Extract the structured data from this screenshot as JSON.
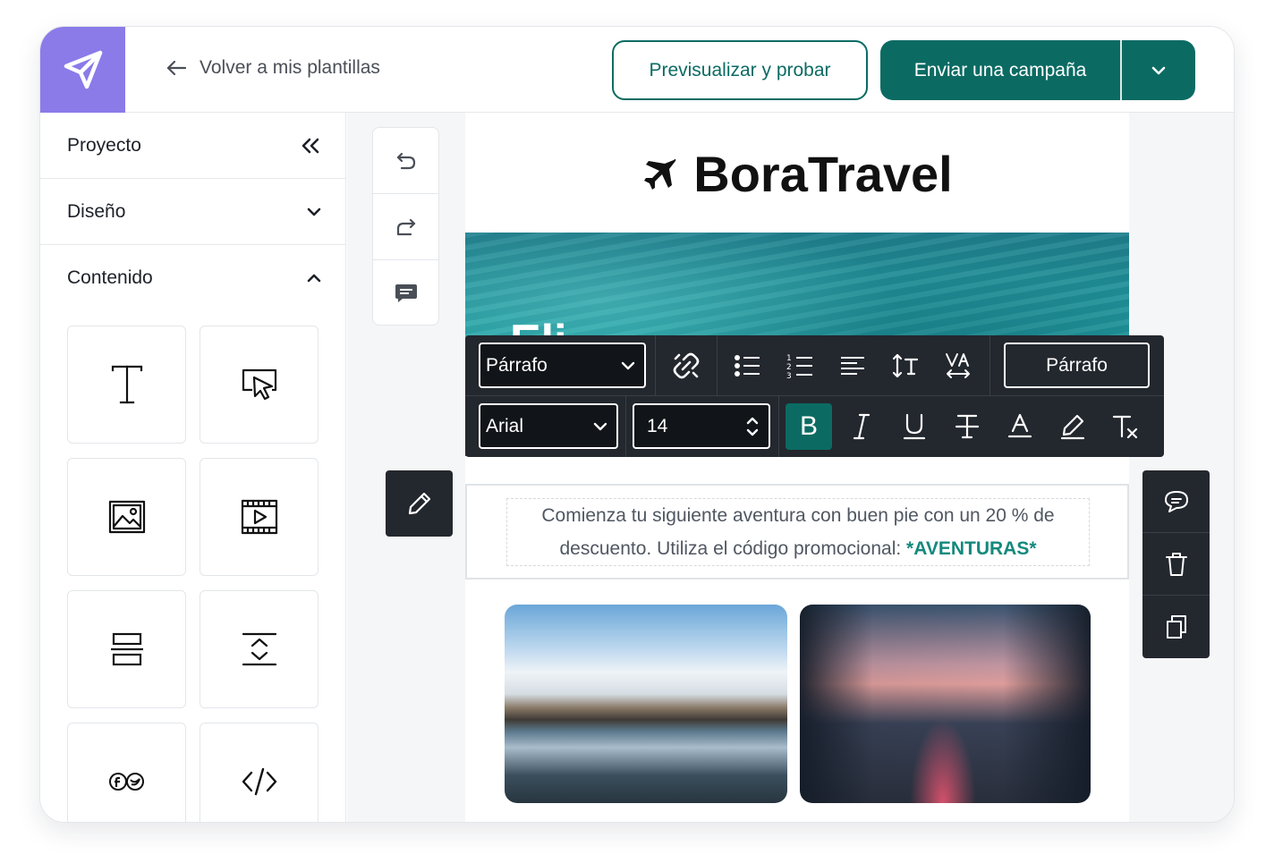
{
  "header": {
    "back_label": "Volver a mis plantillas",
    "preview_label": "Previsualizar y probar",
    "send_label": "Enviar una campaña"
  },
  "sidebar": {
    "sections": [
      {
        "label": "Proyecto",
        "state": "collapse-all"
      },
      {
        "label": "Diseño",
        "state": "collapsed"
      },
      {
        "label": "Contenido",
        "state": "expanded"
      }
    ],
    "content_blocks": [
      "text-icon",
      "button-icon",
      "image-icon",
      "video-icon",
      "divider-icon",
      "spacer-icon",
      "social-icon",
      "code-icon"
    ]
  },
  "email": {
    "brand_name": "BoraTravel",
    "hero_text": "Eli",
    "body_text": "Comienza tu siguiente aventura con buen pie con un 20 % de descuento. Utiliza el código promocional:",
    "promo_code": "*AVENTURAS*"
  },
  "toolbar": {
    "block_type": "Párrafo",
    "style_button": "Párrafo",
    "font_family": "Arial",
    "font_size": "14",
    "bold_label": "B"
  },
  "colors": {
    "accent": "#0b6b63",
    "logo_tile": "#8a7be9",
    "promo": "#14897d",
    "dark_toolbar": "#23272e"
  }
}
